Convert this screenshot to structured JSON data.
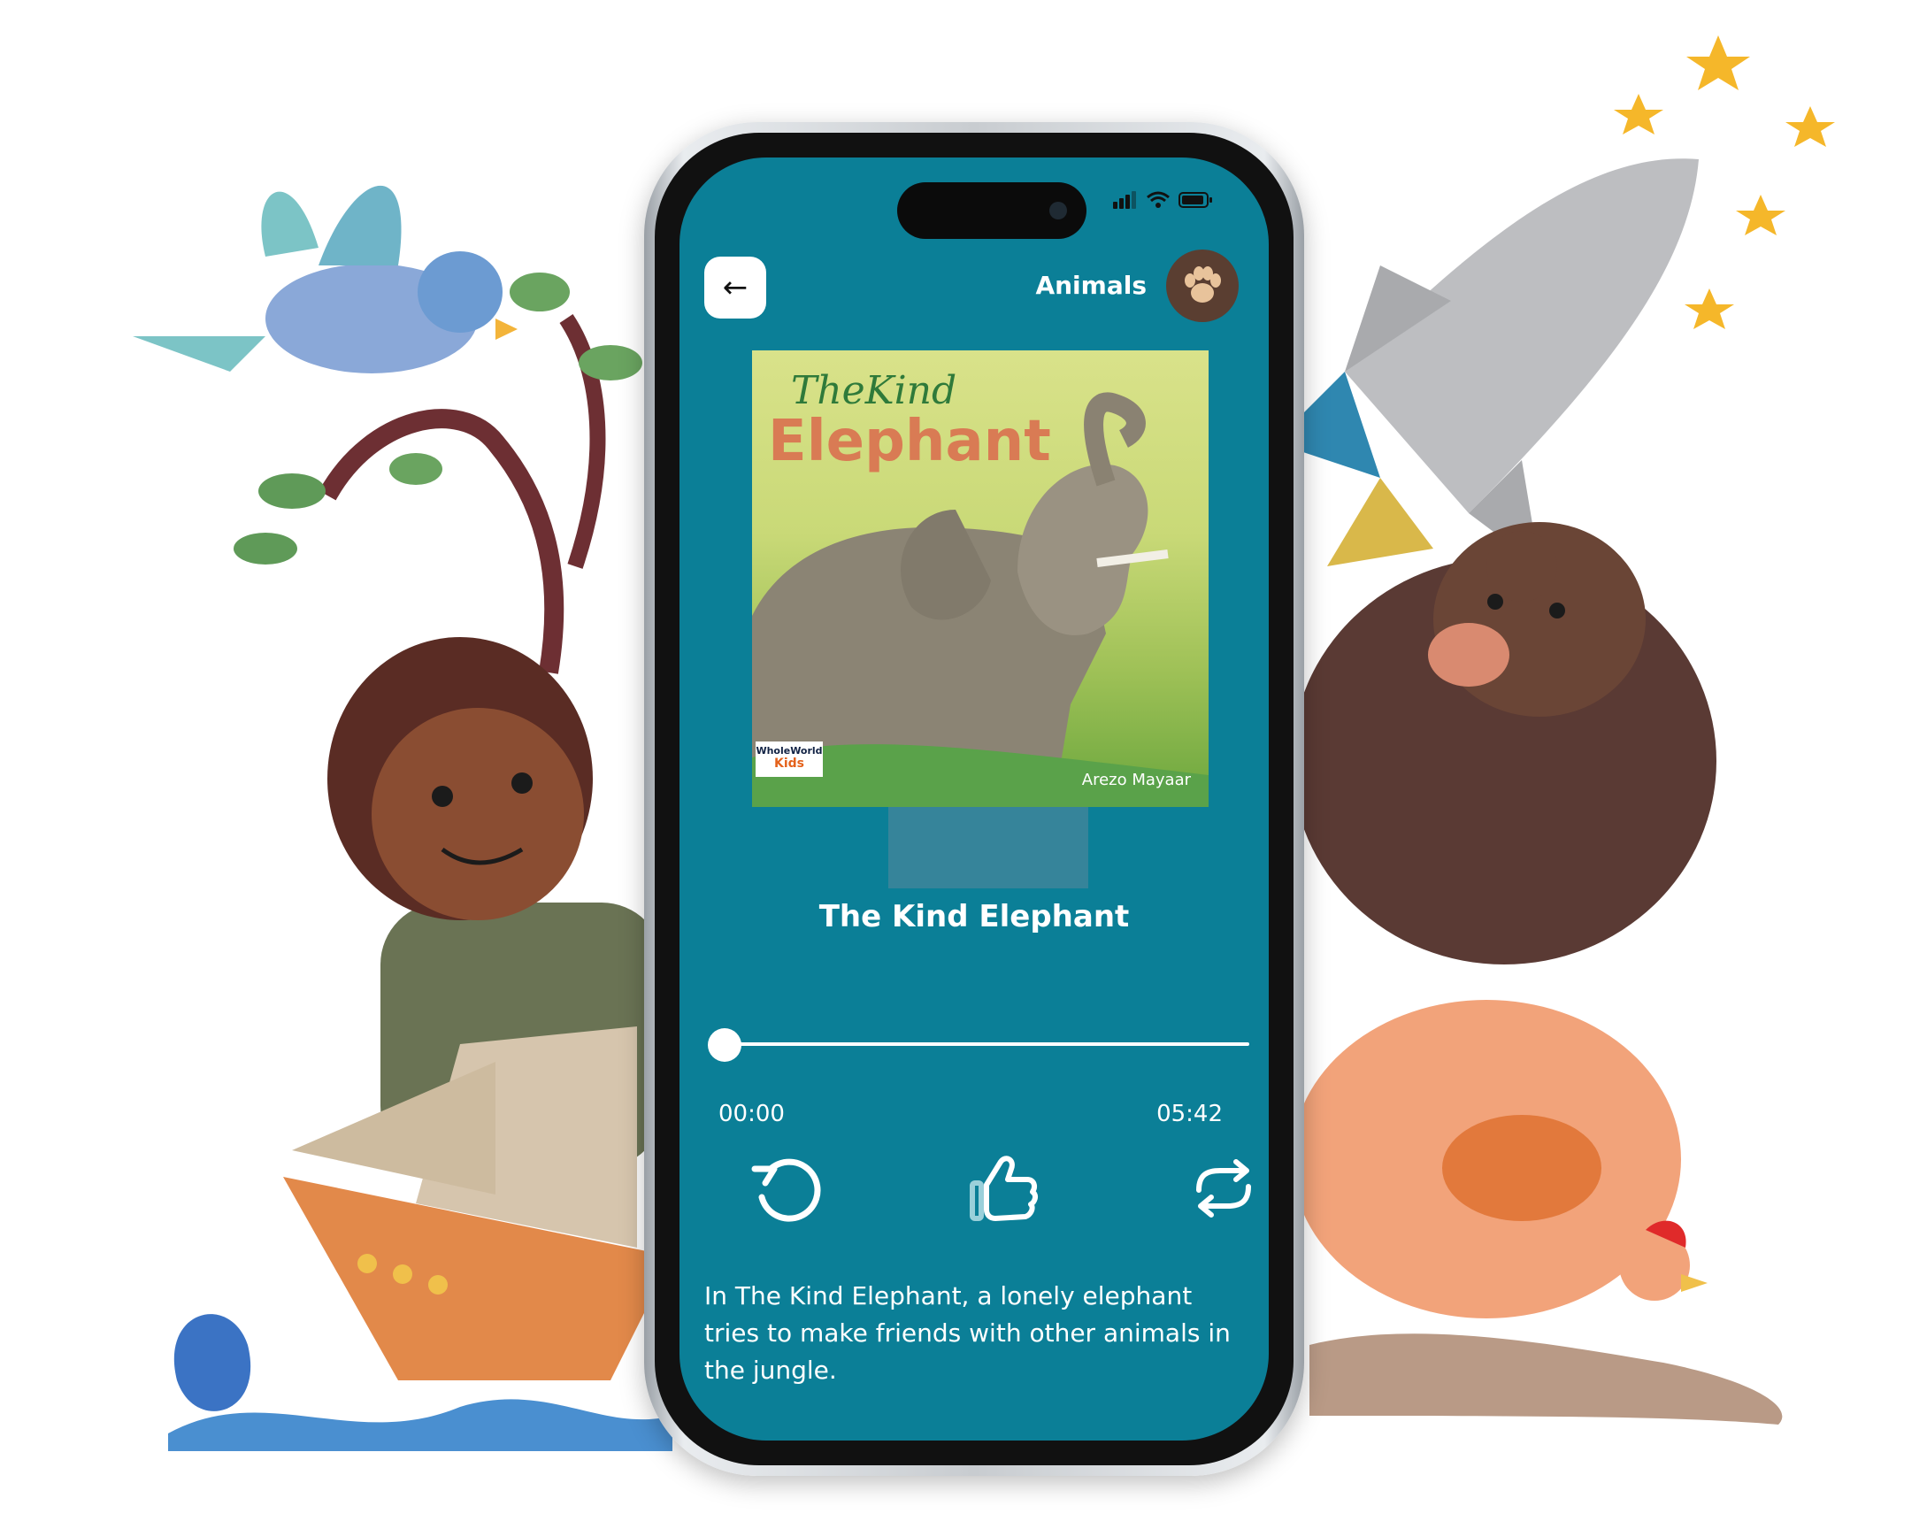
{
  "header": {
    "back_label": "←",
    "category_label": "Animals",
    "category_icon": "paw-icon"
  },
  "cover": {
    "title_line_1": "TheKind",
    "title_line_2": "Elephant",
    "author": "Arezo Mayaar",
    "publisher_top": "WholeWorld",
    "publisher_bottom": "Kids"
  },
  "track": {
    "title": "The Kind Elephant",
    "time_elapsed": "00:00",
    "time_total": "05:42",
    "progress": 0
  },
  "controls": {
    "replay_icon": "replay-icon",
    "like_icon": "thumbs-up-icon",
    "repeat_icon": "repeat-icon"
  },
  "description": "In The Kind Elephant, a lonely elephant tries to make friends with other animals in the jungle.",
  "colors": {
    "screen_bg": "#0b7f97",
    "accent_white": "#ffffff"
  }
}
